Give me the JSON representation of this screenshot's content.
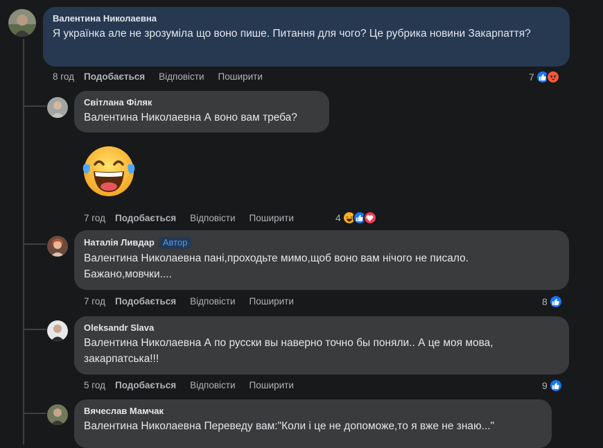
{
  "comments": [
    {
      "author": "Валентина Николаевна",
      "text": "Я українка але не зрозуміла що воно пише. Питання для чого? Це рубрика новини Закарпаття?",
      "time": "8 год",
      "reaction_count": "7",
      "reactions": [
        "like-icon",
        "angry-icon"
      ]
    },
    {
      "author": "Світлана Філяк",
      "text": "Валентина Николаевна А воно вам треба?",
      "sticker": "laughing-emoji-sticker",
      "time": "7 год",
      "reaction_count": "4",
      "reactions": [
        "haha-icon",
        "like-icon",
        "love-icon"
      ]
    },
    {
      "author": "Наталія Ливдар",
      "badge": "Автор",
      "text": "Валентина Николаевна пані,проходьте мимо,щоб воно вам нічого не писало. Бажано,мовчки....",
      "time": "7 год",
      "reaction_count": "8",
      "reactions": [
        "like-icon"
      ]
    },
    {
      "author": "Oleksandr Slava",
      "text": "Валентина Николаевна А по русски вы наверно точно бы поняли.. А це моя мова, закарпатська!!!",
      "time": "5 год",
      "reaction_count": "9",
      "reactions": [
        "like-icon"
      ]
    },
    {
      "author": "Вячеслав Мамчак",
      "text": "Валентина Николаевна Переведу вам:\"Коли і це не допоможе,то я вже не знаю...\""
    }
  ],
  "actions": {
    "like": "Подобається",
    "reply": "Відповісти",
    "share": "Поширити"
  },
  "colors": {
    "background": "#18191a",
    "main_bubble": "#263951",
    "reply_bubble": "#3a3b3c",
    "like_blue": "#1877f2",
    "muted_text": "#b0b3b8"
  }
}
